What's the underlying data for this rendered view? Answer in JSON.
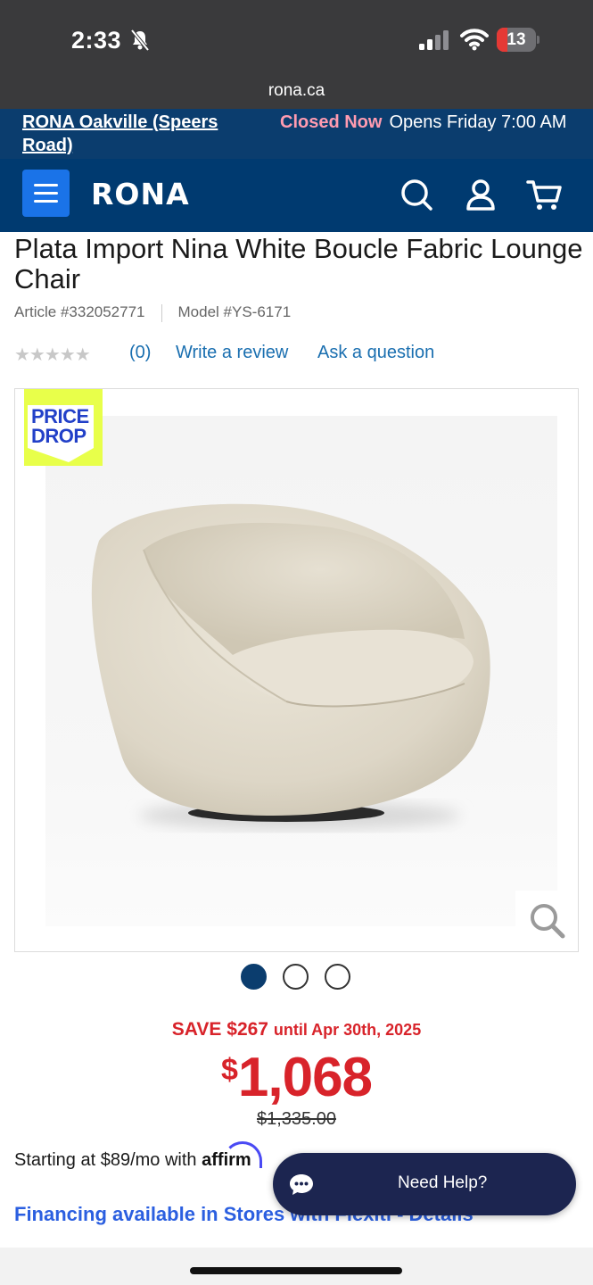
{
  "status_bar": {
    "time": "2:33",
    "battery_level": "13",
    "battery_fraction": 0.13
  },
  "browser": {
    "url": "rona.ca"
  },
  "store_bar": {
    "store_name": "RONA Oakville (Speers Road)",
    "status": "Closed Now",
    "opens": "Opens Friday 7:00 AM"
  },
  "nav": {
    "logo": "RONA",
    "icons": [
      "menu-icon",
      "search-icon",
      "account-icon",
      "cart-icon"
    ]
  },
  "product": {
    "title": "Plata Import Nina White Boucle Fabric Lounge Chair",
    "article": "Article #332052771",
    "model": "Model #YS-6171",
    "rating_stars": "★★★★★",
    "rating_value": 0,
    "rating_count": "(0)",
    "write_review": "Write a review",
    "ask_question": "Ask a question",
    "badge_line1": "PRICE",
    "badge_line2": "DROP",
    "gallery_total": 3,
    "gallery_active": 1
  },
  "pricing": {
    "save": "SAVE $267",
    "save_until": "until Apr 30th, 2025",
    "currency": "$",
    "price": "1,068",
    "old_price": "$1,335.00"
  },
  "financing": {
    "affirm_prefix": "Starting at $89/mo with",
    "affirm_logo": "affirm",
    "financing_text": "Financing available in Stores with Flexiti - Details"
  },
  "help": {
    "label": "Need Help?"
  },
  "colors": {
    "brand_blue": "#003a70",
    "store_bar": "#0b3d6e",
    "sale_red": "#d8232a",
    "link_blue": "#1a6fb0",
    "badge_yellow": "#e8ff4a"
  }
}
